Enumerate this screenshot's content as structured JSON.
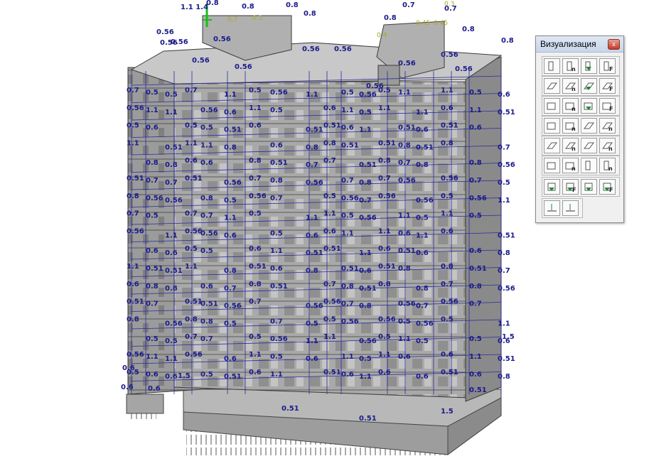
{
  "palette": {
    "title": "Визуализация",
    "close_label": "x",
    "rows": [
      [
        "wall-icon",
        "wall-n-icon",
        "wall-down-icon",
        "wall-force-icon"
      ],
      [
        "slab-icon",
        "slab-n-icon",
        "slab-down-icon",
        "slab-force-icon"
      ],
      [
        "box-icon",
        "box-n-icon",
        "box-down-icon",
        "box-force-icon"
      ],
      [
        "rect-icon",
        "rect-n-icon",
        "beam-icon",
        "beam-n-icon"
      ],
      [
        "plate-icon",
        "plate-n-icon",
        "ramp-icon",
        "ramp-n-icon"
      ],
      [
        "block-icon",
        "block-n-icon",
        "column-icon",
        "column-n-icon"
      ],
      [
        "support-down-icon",
        "support-force-icon",
        "load-icon",
        "load-force-icon"
      ],
      [
        "level-icon",
        "levels-icon"
      ]
    ],
    "letters": {
      "n": "n",
      "f": "F"
    }
  },
  "model": {
    "labels_blue": [
      "0.8",
      "0.7",
      "0.56",
      "0.5",
      "1.1",
      "0.6",
      "0.51",
      "1.5",
      "0.45",
      "0.3",
      "1.1 1.4"
    ],
    "labels_yellow": [
      "0.3",
      "0.7",
      "0.45",
      "0.4"
    ],
    "bottom_labels": [
      "0.51",
      "0.51",
      "0.51",
      "1.5",
      "1.5"
    ]
  }
}
